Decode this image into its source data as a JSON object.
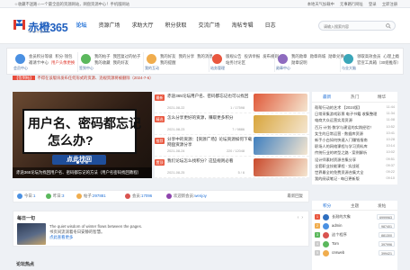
{
  "topbar": {
    "left": "☆收藏不迷路☆一个最全面的资源网站，网盘资源中心！手机版网站",
    "right": [
      "本地天气加载中",
      "无事路行网址",
      "登录",
      "立即注册"
    ]
  },
  "logo": {
    "text": "赤橙365",
    "sub": "chicheng365.com"
  },
  "nav": {
    "items": [
      "论坛",
      "资源广场",
      "求助大厅",
      "积分获取",
      "交流广场",
      "淘帖专辑",
      "日志"
    ],
    "active_index": 0
  },
  "search": {
    "placeholder": "请输入搜索内容"
  },
  "quick": [
    {
      "caption": "会员中心",
      "links": [
        {
          "t": "会员积分等级",
          "red": false
        },
        {
          "t": "积分·钱包",
          "red": false
        },
        {
          "t": "邀请卡中心",
          "red": false
        },
        {
          "t": "用户头像更换",
          "red": true
        }
      ]
    },
    {
      "caption": "签到中心",
      "links": [
        {
          "t": "我的帖子",
          "red": false
        },
        {
          "t": "我回复过的帖子",
          "red": false
        },
        {
          "t": "我的收藏",
          "red": false
        },
        {
          "t": "我的好友",
          "red": false
        }
      ]
    },
    {
      "caption": "我的互动",
      "links": [
        {
          "t": "我的好友",
          "red": false
        },
        {
          "t": "我的分享",
          "red": false
        },
        {
          "t": "我的消息",
          "red": false
        },
        {
          "t": "我的提醒",
          "red": false
        }
      ]
    },
    {
      "caption": "站务管理",
      "links": [
        {
          "t": "版规公告",
          "red": false
        },
        {
          "t": "投诉举报",
          "red": false
        },
        {
          "t": "发布规则",
          "red": false
        },
        {
          "t": "站务讨论区",
          "red": false
        }
      ]
    },
    {
      "caption": "勋章中心",
      "links": [
        {
          "t": "我的勋章",
          "red": false
        },
        {
          "t": "勋章商城",
          "red": false
        },
        {
          "t": "勋章兑换",
          "red": false
        },
        {
          "t": "勋章说明",
          "red": false
        }
      ]
    },
    {
      "caption": "与业大脑",
      "links": [
        {
          "t": "领取高效会员",
          "red": false
        },
        {
          "t": "心理上瘾",
          "red": false
        },
        {
          "t": "官宣工具箱（30组推荐）",
          "red": false
        }
      ]
    }
  ],
  "ticker": {
    "tag": "【签到帖】",
    "text": "不得在该版块发布任何形式的资源、违规资源将被删除（2024-7-6）"
  },
  "banner": {
    "line1": "用户名、密码都忘记",
    "line2": "怎么办?",
    "chip": "点此找回",
    "caption": "赤途365论坛为找回用户名、密码都忘记的方法（用户名密码找回教程）"
  },
  "hot": [
    {
      "badge": "最新",
      "title": "赤途365论坛用户名、密码都忘记也可以找回",
      "date": "2021-08-22",
      "stat": "1 / 17598",
      "thumb": "#e05a3a"
    },
    {
      "badge": "精选",
      "title": "怎么分享更好的资源，赚取更多积分",
      "date": "2021-08-23",
      "stat": "7 / 9886",
      "thumb": "#d8a53c"
    },
    {
      "badge": "推荐",
      "title": "分享中的资源：【资源广场】论坛资源如何下载 网盘资源分享",
      "date": "2021-08-24",
      "stat": "220 / 12048",
      "thumb": "#3f7fbf"
    },
    {
      "badge": "置顶",
      "title": "我们论坛怎么找积分？这些规则必看",
      "date": "2021-08-25",
      "stat": "5 / 6",
      "thumb": "#c94a2c"
    }
  ],
  "stats": [
    {
      "label": "今日:",
      "value": "1",
      "color": "#4a90e2"
    },
    {
      "label": "昨日:",
      "value": "3",
      "color": "#5bb85d"
    },
    {
      "label": "帖子:",
      "value": "297881",
      "color": "#f0ad4e"
    },
    {
      "label": "会员:",
      "value": "17096",
      "color": "#d9534f"
    },
    {
      "label": "欢迎新会员:",
      "value": "wenjoy",
      "color": "#8e44ad"
    }
  ],
  "stats_more": "最新回复",
  "daily": {
    "title": "每日一句",
    "line1": "The quiet wisdom of winter flows between the pages.",
    "line2": "书页间流淌着冬日安静的智慧。",
    "line3": "点此查看更多"
  },
  "bottom_heading": "论坛热点",
  "side": {
    "tabs": [
      "最新",
      "热门",
      "精华"
    ],
    "active_tab": 0,
    "rows": [
      {
        "text": "帮帮行动的艺术 【2024版】",
        "time": "11:44"
      },
      {
        "text": "日常采集游戏彩票 电子书籍 收集整理",
        "time": "11:34"
      },
      {
        "text": "电商大众运营实用资源",
        "time": "11:08"
      },
      {
        "text": "百万·计划·数学与建设的实践经验！",
        "time": "10:52"
      },
      {
        "text": "女生的日常运营 - 数据库资源",
        "time": "10:41"
      },
      {
        "text": "新手小白如何快速入门赚钱指南",
        "time": "10:28"
      },
      {
        "text": "职场人的网络课程与学习资料库",
        "time": "10:14"
      },
      {
        "text": "传统行业的转型之路 - 案例解析",
        "time": "10:02"
      },
      {
        "text": "设计师素材资源合集分享",
        "time": "09:51"
      },
      {
        "text": "全套职业技能课程 - 实战班",
        "time": "09:37"
      },
      {
        "text": "世界最全的免费资源合集大全",
        "time": "09:22"
      },
      {
        "text": "我的阅读笔记 - 每日更新版",
        "time": "09:10"
      }
    ],
    "tabs2": [
      "积分",
      "主题",
      "发帖"
    ],
    "active_tab2": 0,
    "ranks": [
      {
        "name": "长耐的大象",
        "value": "6999963",
        "color": "#2f6fbf"
      },
      {
        "name": "admin",
        "value": "987401",
        "color": "#4a90e2"
      },
      {
        "name": "这个程序",
        "value": "881300",
        "color": "#d9534f"
      },
      {
        "name": "Tom",
        "value": "397996",
        "color": "#5bb85d"
      },
      {
        "name": "cnsweb",
        "value": "399421",
        "color": "#f0ad4e"
      }
    ]
  }
}
